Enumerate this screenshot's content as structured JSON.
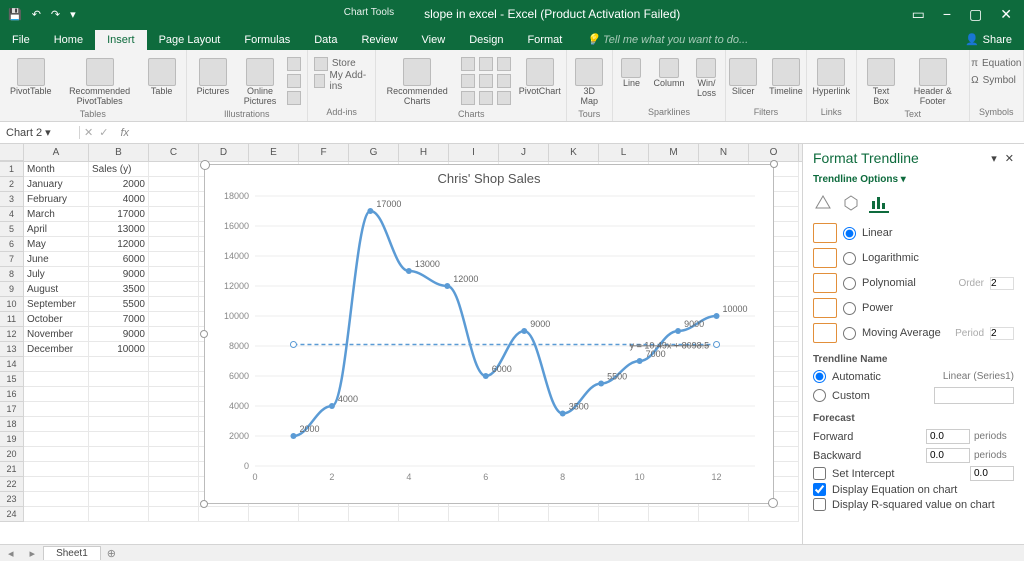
{
  "titlebar": {
    "chart_tools": "Chart Tools",
    "document": "slope in excel - Excel (Product Activation Failed)",
    "share": "Share"
  },
  "tabs": [
    "File",
    "Home",
    "Insert",
    "Page Layout",
    "Formulas",
    "Data",
    "Review",
    "View",
    "Design",
    "Format"
  ],
  "active_tab": "Insert",
  "tellme": "Tell me what you want to do...",
  "ribbon": {
    "tables": {
      "label": "Tables",
      "pivottable": "PivotTable",
      "recpivot": "Recommended\nPivotTables",
      "table": "Table"
    },
    "illustrations": {
      "label": "Illustrations",
      "pictures": "Pictures",
      "online": "Online\nPictures"
    },
    "addins": {
      "label": "Add-ins",
      "store": "Store",
      "myaddins": "My Add-ins"
    },
    "charts": {
      "label": "Charts",
      "rec": "Recommended\nCharts",
      "pivotchart": "PivotChart"
    },
    "tours": {
      "label": "Tours",
      "map": "3D\nMap"
    },
    "sparklines": {
      "label": "Sparklines",
      "line": "Line",
      "col": "Column",
      "wl": "Win/\nLoss"
    },
    "filters": {
      "label": "Filters",
      "slicer": "Slicer",
      "timeline": "Timeline"
    },
    "links": {
      "label": "Links",
      "hyper": "Hyperlink"
    },
    "text": {
      "label": "Text",
      "tb": "Text\nBox",
      "hf": "Header\n& Footer"
    },
    "symbols": {
      "label": "Symbols",
      "eq": "Equation",
      "sym": "Symbol"
    }
  },
  "formula_bar": {
    "name": "Chart 2",
    "fx": "fx"
  },
  "columns": [
    "A",
    "B",
    "C",
    "D",
    "E",
    "F",
    "G",
    "H",
    "I",
    "J",
    "K",
    "L",
    "M",
    "N",
    "O"
  ],
  "data_rows": [
    {
      "n": 1,
      "a": "Month",
      "b": "Sales (y)"
    },
    {
      "n": 2,
      "a": "January",
      "b": "2000"
    },
    {
      "n": 3,
      "a": "February",
      "b": "4000"
    },
    {
      "n": 4,
      "a": "March",
      "b": "17000"
    },
    {
      "n": 5,
      "a": "April",
      "b": "13000"
    },
    {
      "n": 6,
      "a": "May",
      "b": "12000"
    },
    {
      "n": 7,
      "a": "June",
      "b": "6000"
    },
    {
      "n": 8,
      "a": "July",
      "b": "9000"
    },
    {
      "n": 9,
      "a": "August",
      "b": "3500"
    },
    {
      "n": 10,
      "a": "September",
      "b": "5500"
    },
    {
      "n": 11,
      "a": "October",
      "b": "7000"
    },
    {
      "n": 12,
      "a": "November",
      "b": "9000"
    },
    {
      "n": 13,
      "a": "December",
      "b": "10000"
    }
  ],
  "chart_data": {
    "type": "line",
    "title": "Chris' Shop Sales",
    "x": [
      1,
      2,
      3,
      4,
      5,
      6,
      7,
      8,
      9,
      10,
      11,
      12
    ],
    "series": [
      {
        "name": "Series1",
        "values": [
          2000,
          4000,
          17000,
          13000,
          12000,
          6000,
          9000,
          3500,
          5500,
          7000,
          9000,
          10000
        ]
      }
    ],
    "trendline": {
      "type": "Linear",
      "equation": "y = 10.49x + 8098.5",
      "intercept_approx": 8098
    },
    "ylim": [
      0,
      18000
    ],
    "xticks": [
      0,
      2,
      4,
      6,
      8,
      10,
      12
    ],
    "yticks": [
      0,
      2000,
      4000,
      6000,
      8000,
      10000,
      12000,
      14000,
      16000,
      18000
    ]
  },
  "panel": {
    "title": "Format Trendline",
    "subtitle": "Trendline Options ▾",
    "options": [
      "Linear",
      "Logarithmic",
      "Polynomial",
      "Power",
      "Moving Average"
    ],
    "selected": "Linear",
    "order_label": "Order",
    "order_val": "2",
    "period_label": "Period",
    "period_val": "2",
    "name_section": "Trendline Name",
    "automatic": "Automatic",
    "auto_val": "Linear (Series1)",
    "custom": "Custom",
    "forecast_section": "Forecast",
    "forward": "Forward",
    "forward_val": "0.0",
    "backward": "Backward",
    "backward_val": "0.0",
    "periods": "periods",
    "set_intercept": "Set Intercept",
    "set_intercept_val": "0.0",
    "disp_eq": "Display Equation on chart",
    "disp_r2": "Display R-squared value on chart"
  },
  "bottom": {
    "sheet": "Sheet1"
  }
}
